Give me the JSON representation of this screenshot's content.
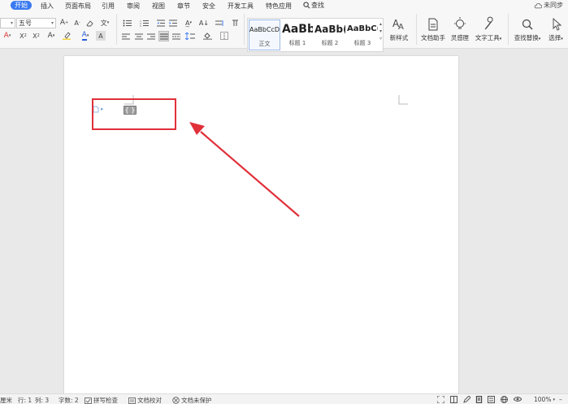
{
  "menu": {
    "tabs": [
      "开始",
      "插入",
      "页面布局",
      "引用",
      "审阅",
      "视图",
      "章节",
      "安全",
      "开发工具",
      "特色应用"
    ],
    "search_label": "查找",
    "sync_label": "未同步"
  },
  "ribbon": {
    "font_size": "五号",
    "styles": [
      {
        "sample": "AaBbCcDd",
        "name": "正文"
      },
      {
        "sample": "AaBb",
        "name": "标题 1"
      },
      {
        "sample": "AaBb(",
        "name": "标题 2"
      },
      {
        "sample": "AaBbC(",
        "name": "标题 3"
      }
    ],
    "new_style_label": "新样式",
    "doc_assistant_label": "文档助手",
    "inspiration_label": "灵感匣",
    "text_tools_label": "文字工具",
    "find_replace_label": "查找替换",
    "select_label": "选择"
  },
  "document": {
    "highlight_color": "#e0303a",
    "arrow_color": "#e0303a"
  },
  "status": {
    "unit_label": "厘米",
    "row": "行: 1",
    "col": "列: 3",
    "word_count": "字数: 2",
    "spell_check": "拼写检查",
    "doc_proof": "文档校对",
    "protect": "文档未保护",
    "zoom": "100%"
  }
}
